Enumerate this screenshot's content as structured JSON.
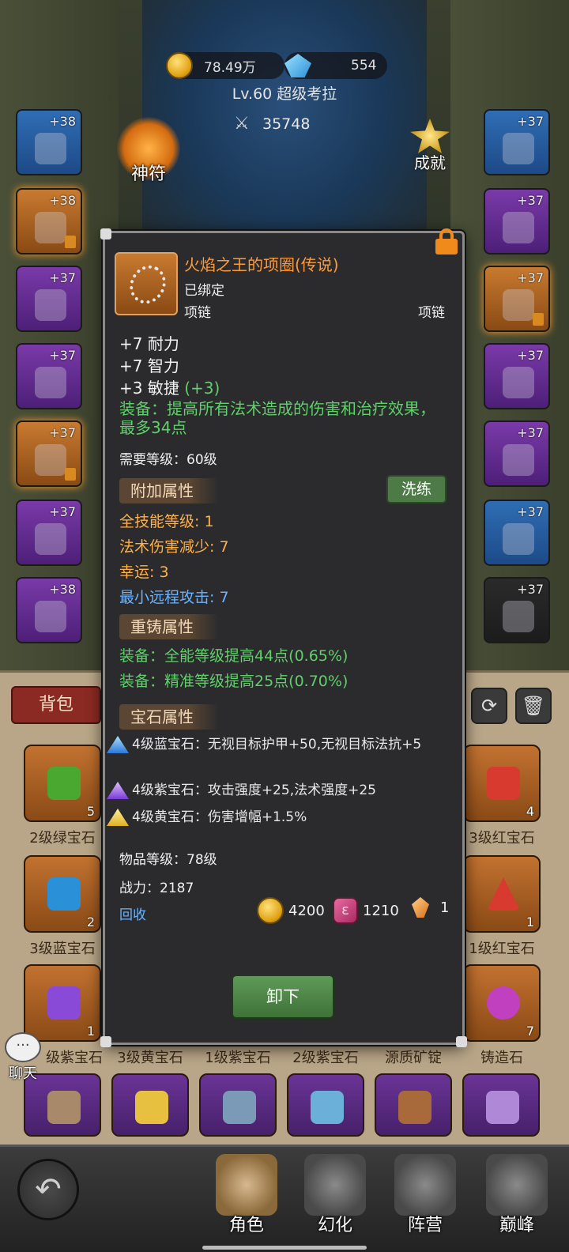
{
  "header": {
    "gold": "78.49万",
    "diamonds": "554",
    "hero": "Lv.60 超级考拉",
    "combat_power": "35748",
    "talisman_label": "神符",
    "achievement_label": "成就"
  },
  "equipment_slots": {
    "left": [
      {
        "level": "+38",
        "rarity": "blue"
      },
      {
        "level": "+38",
        "rarity": "orange",
        "locked": true
      },
      {
        "level": "+37",
        "rarity": "purple"
      },
      {
        "level": "+37",
        "rarity": "purple"
      },
      {
        "level": "+37",
        "rarity": "orange",
        "locked": true
      },
      {
        "level": "+37",
        "rarity": "purple"
      },
      {
        "level": "+38",
        "rarity": "purple"
      }
    ],
    "right": [
      {
        "level": "+37",
        "rarity": "blue"
      },
      {
        "level": "+37",
        "rarity": "purple"
      },
      {
        "level": "+37",
        "rarity": "orange",
        "locked": true
      },
      {
        "level": "+37",
        "rarity": "purple"
      },
      {
        "level": "+37",
        "rarity": "purple"
      },
      {
        "level": "+37",
        "rarity": "blue"
      },
      {
        "level": "+37",
        "rarity": "dark"
      }
    ]
  },
  "tooltip": {
    "item_name": "火焰之王的项圈(传说)",
    "bound": "已绑定",
    "slot_left": "项链",
    "slot_right": "项链",
    "stats": [
      {
        "text": "+7 耐力",
        "bonus": ""
      },
      {
        "text": "+7 智力",
        "bonus": ""
      },
      {
        "text": "+3 敏捷 ",
        "bonus": "(+3)"
      }
    ],
    "equip_effect": "装备：提高所有法术造成的伤害和治疗效果，最多34点",
    "required_level": "需要等级：60级",
    "extra_title": "附加属性",
    "refine_label": "洗练",
    "extra_attrs": [
      {
        "text": "全技能等级: 1",
        "color": "orange"
      },
      {
        "text": "法术伤害减少: 7",
        "color": "orange"
      },
      {
        "text": "幸运: 3",
        "color": "orange"
      },
      {
        "text": "最小远程攻击: 7",
        "color": "blue"
      }
    ],
    "reforge_title": "重铸属性",
    "reforge_attrs": [
      "装备：全能等级提高44点(0.65%)",
      "装备：精准等级提高25点(0.70%)"
    ],
    "gem_title": "宝石属性",
    "gems": [
      {
        "text": "4级蓝宝石：无视目标护甲+50,无视目标法抗+5",
        "color": "#5aa8ff"
      },
      {
        "text": "4级紫宝石：攻击强度+25,法术强度+25",
        "color": "#b07ae8"
      },
      {
        "text": "4级黄宝石：伤害增幅+1.5%",
        "color": "#f0d040"
      }
    ],
    "item_level": "物品等级：78级",
    "combat_power": "战力：2187",
    "recycle_label": "回收",
    "price_gold": "4200",
    "price_rune": "1210",
    "price_shard": "1",
    "rune_glyph": "ε",
    "unequip_label": "卸下"
  },
  "bag": {
    "tab_label": "背包",
    "items": [
      {
        "name": "2级绿宝石",
        "count": "5",
        "color": "#4aa830"
      },
      {
        "name": "3级红宝石",
        "count": "4",
        "color": "#d83a30"
      },
      {
        "name": "3级蓝宝石",
        "count": "2",
        "color": "#2a90d8"
      },
      {
        "name": "1级红宝石",
        "count": "1",
        "color": "#d83a30"
      },
      {
        "name": "级紫宝石",
        "count": "1",
        "color": "#8a4ad8"
      },
      {
        "name": "铸造石",
        "count": "7",
        "color": "#c040c0"
      }
    ],
    "row3_names": [
      "3级黄宝石",
      "1级紫宝石",
      "2级紫宝石",
      "源质矿锭"
    ],
    "refresh_icon": "⟳",
    "trash_icon": "🗑"
  },
  "chat": {
    "label": "聊天",
    "bubble": "···"
  },
  "nav": {
    "back_icon": "↶",
    "items": [
      "角色",
      "幻化",
      "阵营",
      "巅峰"
    ]
  }
}
